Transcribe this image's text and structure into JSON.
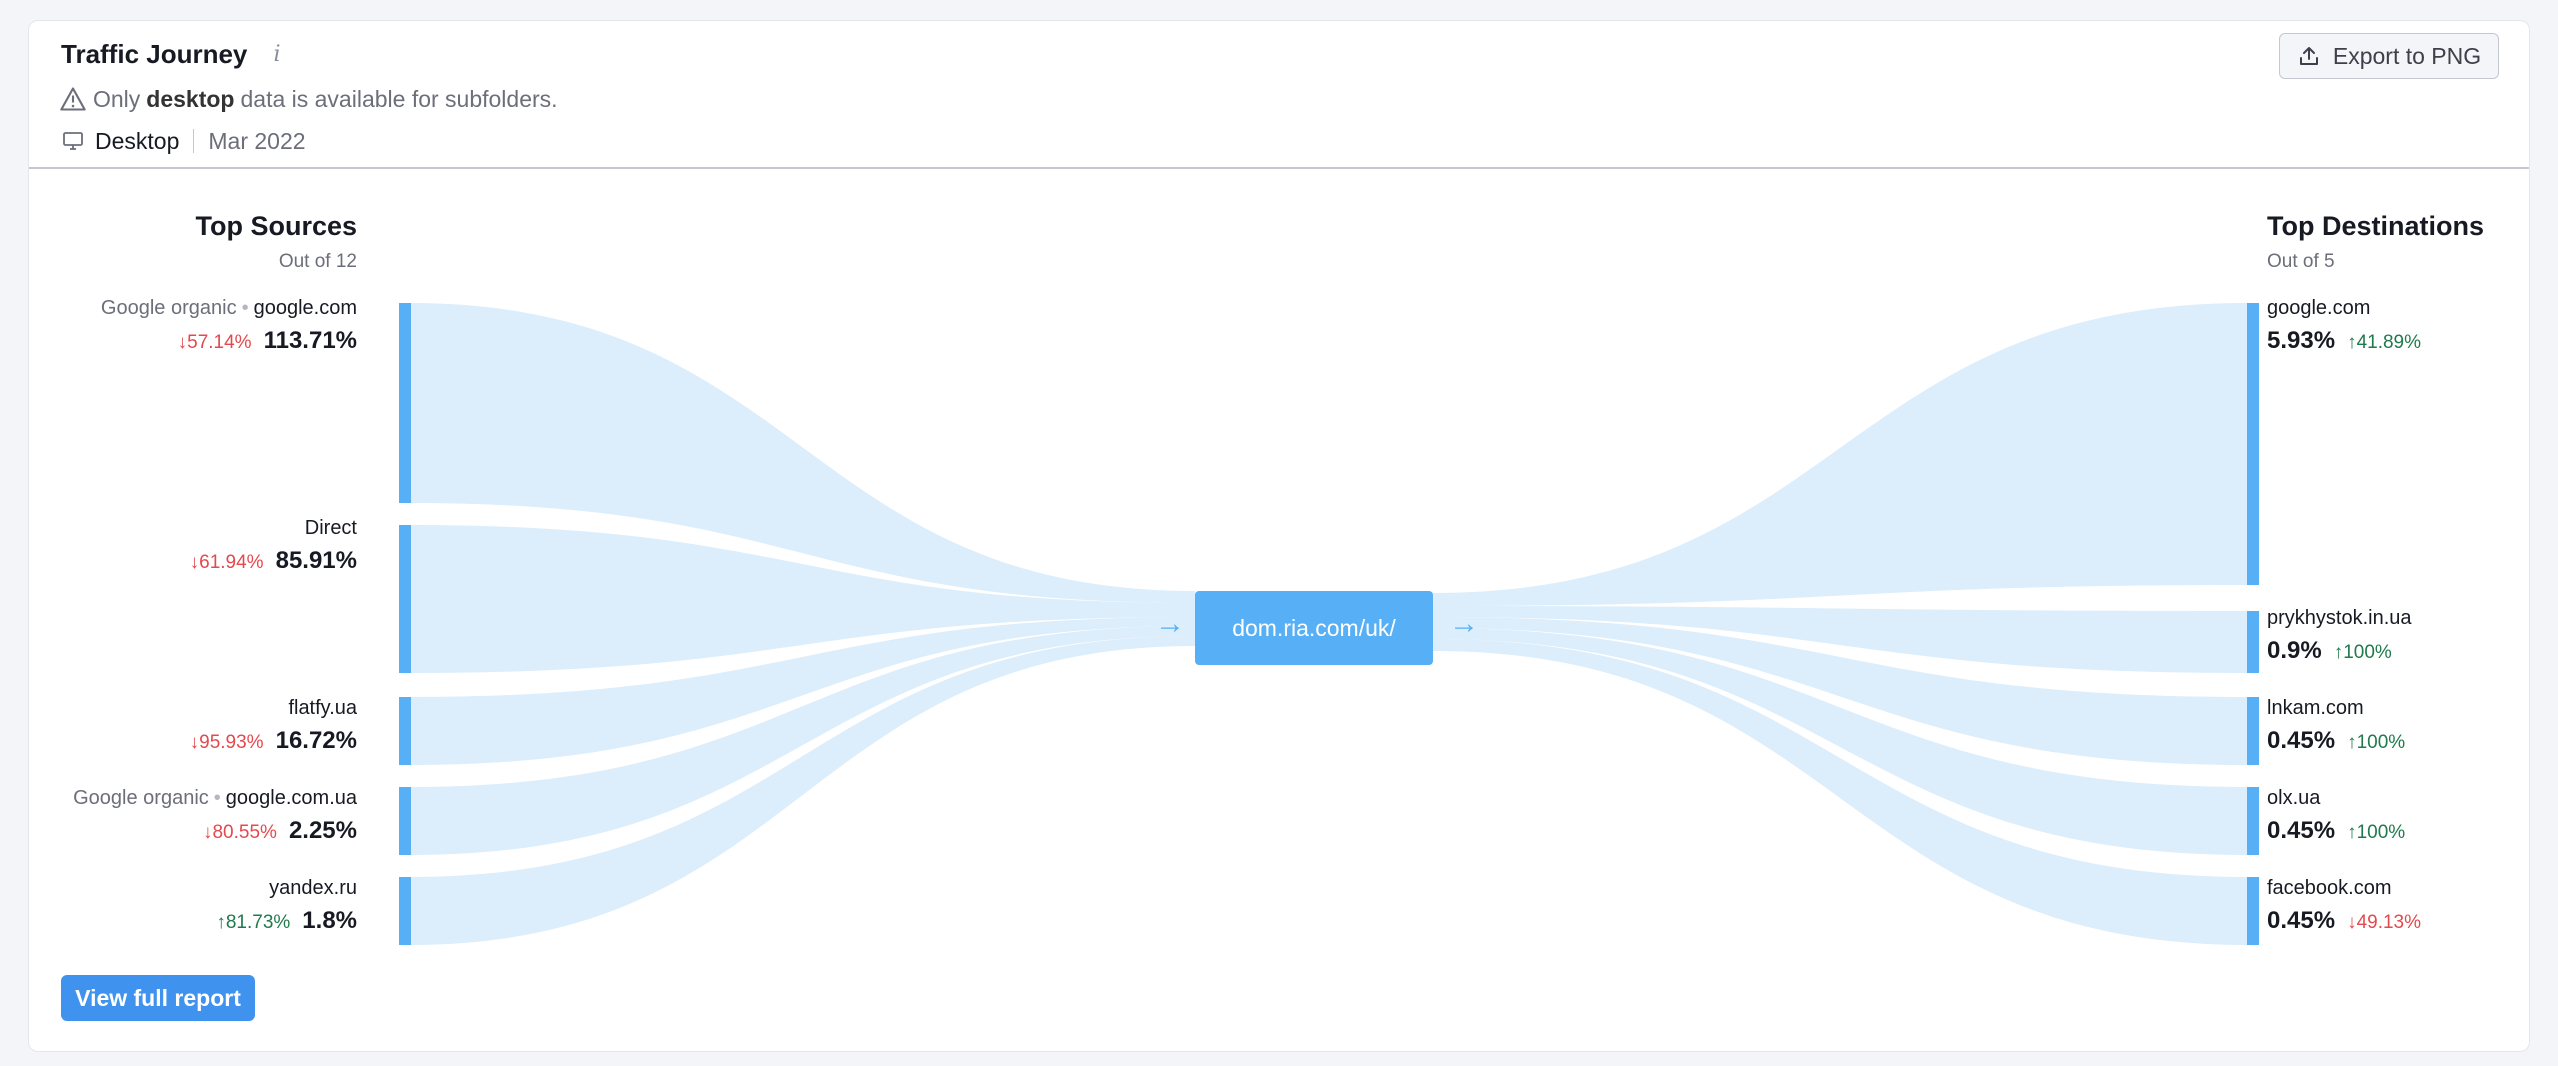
{
  "widget": {
    "title": "Traffic Journey",
    "notice_pre": "Only",
    "notice_bold": "desktop",
    "notice_post": "data is available for subfolders.",
    "device": "Desktop",
    "date": "Mar 2022",
    "export_label": "Export to PNG"
  },
  "sources": {
    "heading": "Top Sources",
    "subheading": "Out of 12",
    "items": [
      {
        "group": "Google organic",
        "name": "google.com",
        "change": "57.14%",
        "dir": "down",
        "share": "113.71%"
      },
      {
        "group": "",
        "name": "Direct",
        "change": "61.94%",
        "dir": "down",
        "share": "85.91%"
      },
      {
        "group": "",
        "name": "flatfy.ua",
        "change": "95.93%",
        "dir": "down",
        "share": "16.72%"
      },
      {
        "group": "Google organic",
        "name": "google.com.ua",
        "change": "80.55%",
        "dir": "down",
        "share": "2.25%"
      },
      {
        "group": "",
        "name": "yandex.ru",
        "change": "81.73%",
        "dir": "up",
        "share": "1.8%"
      }
    ]
  },
  "destinations": {
    "heading": "Top Destinations",
    "subheading": "Out of 5",
    "items": [
      {
        "name": "google.com",
        "share": "5.93%",
        "change": "41.89%",
        "dir": "up"
      },
      {
        "name": "prykhystok.in.ua",
        "share": "0.9%",
        "change": "100%",
        "dir": "up"
      },
      {
        "name": "lnkam.com",
        "share": "0.45%",
        "change": "100%",
        "dir": "up"
      },
      {
        "name": "olx.ua",
        "share": "0.45%",
        "change": "100%",
        "dir": "up"
      },
      {
        "name": "facebook.com",
        "share": "0.45%",
        "change": "49.13%",
        "dir": "down"
      }
    ]
  },
  "center": {
    "label": "dom.ria.com/uk/"
  },
  "footer": {
    "report_label": "View full report"
  },
  "colors": {
    "accent": "#57b0f5",
    "flow": "#dcedfb",
    "down": "#e5484d",
    "up": "#1f7a4c",
    "button": "#3f93ee"
  }
}
